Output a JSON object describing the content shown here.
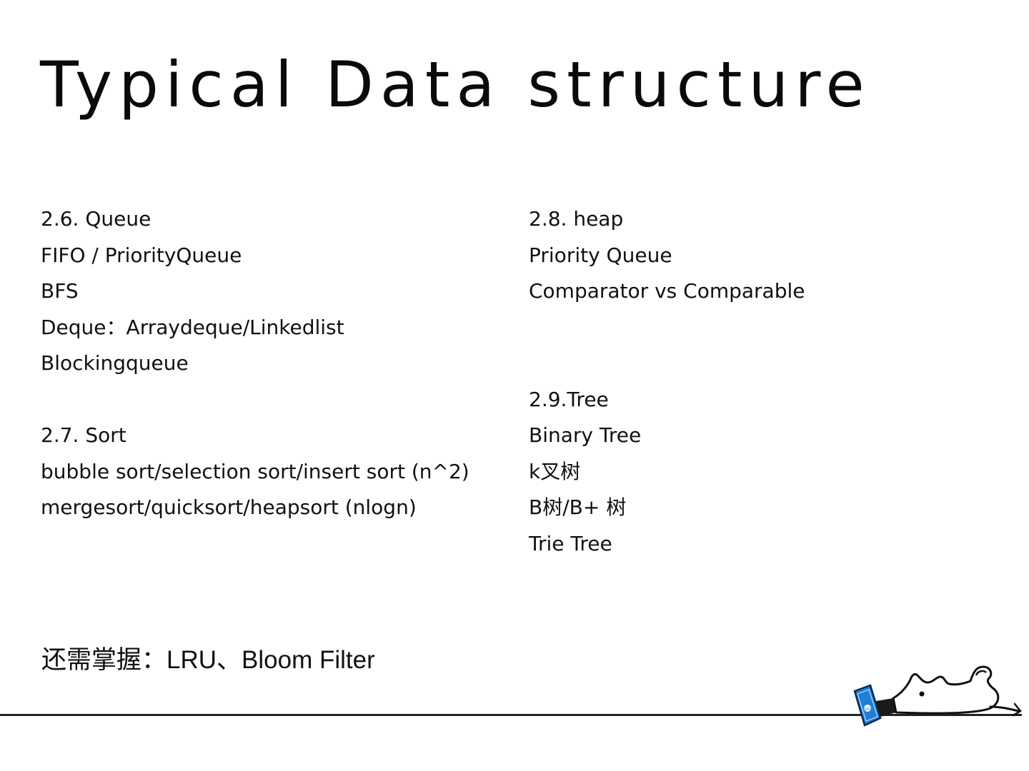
{
  "slide": {
    "title": "Typical Data structure",
    "left_column": {
      "lines": [
        "2.6. Queue",
        "FIFO / PriorityQueue",
        "BFS",
        "Deque：Arraydeque/Linkedlist",
        "Blockingqueue",
        "",
        "2.7. Sort",
        "bubble sort/selection sort/insert sort (n^2)",
        "mergesort/quicksort/heapsort (nlogn)"
      ]
    },
    "right_column": {
      "lines": [
        "2.8. heap",
        "Priority Queue",
        "Comparator vs Comparable",
        "",
        "",
        "2.9.Tree",
        "Binary Tree",
        "k叉树",
        "B树/B+ 树",
        "Trie Tree"
      ]
    },
    "footer_note": {
      "prefix": "还需掌握：",
      "text": "LRU、Bloom Filter"
    },
    "mascot": {
      "icon": "reading-mouse-icon",
      "book_color": "#1f7fd6"
    }
  }
}
